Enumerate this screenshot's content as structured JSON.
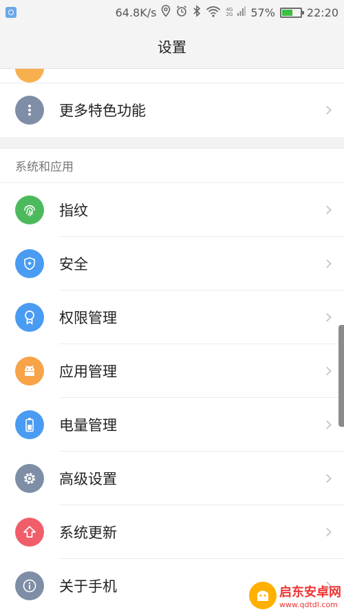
{
  "status_bar": {
    "speed": "64.8K/s",
    "network_4g": "4G",
    "network_2g": "2G",
    "battery_percent": "57%",
    "battery_level": 0.57,
    "time": "22:20",
    "icons": [
      "app-notification-icon",
      "location-icon",
      "alarm-icon",
      "bluetooth-icon",
      "wifi-icon",
      "signal-icon",
      "battery-icon"
    ]
  },
  "header": {
    "title": "设置"
  },
  "top_group": {
    "more_features": "更多特色功能"
  },
  "system_section": {
    "title": "系统和应用",
    "items": [
      {
        "label": "指纹",
        "icon": "fingerprint-icon",
        "color": "#4cba5c"
      },
      {
        "label": "安全",
        "icon": "shield-icon",
        "color": "#4a9bf2"
      },
      {
        "label": "权限管理",
        "icon": "badge-icon",
        "color": "#4a9bf2"
      },
      {
        "label": "应用管理",
        "icon": "android-icon",
        "color": "#f7a348"
      },
      {
        "label": "电量管理",
        "icon": "battery-icon",
        "color": "#4a9bf2"
      },
      {
        "label": "高级设置",
        "icon": "gear-icon",
        "color": "#7e8ea6"
      },
      {
        "label": "系统更新",
        "icon": "upload-arrow-icon",
        "color": "#f05e6a"
      },
      {
        "label": "关于手机",
        "icon": "info-icon",
        "color": "#7e8ea6"
      }
    ]
  },
  "colors": {
    "more_icon": "#7e8ea6",
    "partial_icon": "#f8b04f"
  },
  "watermark": {
    "title": "启东安卓网",
    "url": "www.qdtdl.com"
  }
}
